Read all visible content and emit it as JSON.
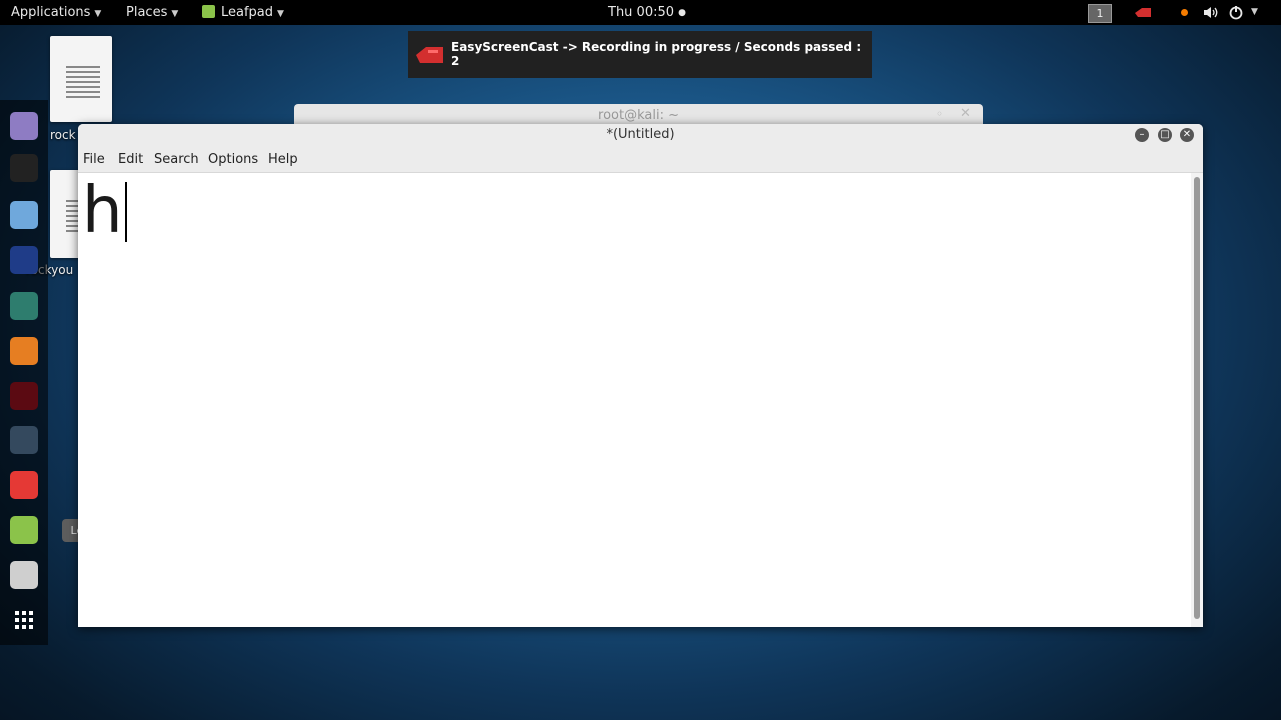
{
  "topbar": {
    "applications": "Applications",
    "places": "Places",
    "app_name": "Leafpad",
    "clock": "Thu 00:50",
    "workspace": "1"
  },
  "notification": {
    "text": "EasyScreenCast -> Recording in progress / Seconds passed : 2",
    "icon": "recording-icon",
    "icon_color": "#d32f2f"
  },
  "desktop": {
    "files": [
      {
        "label": "rock",
        "icon": "text-file-icon"
      },
      {
        "label": "rockyou",
        "icon": "text-file-icon"
      }
    ]
  },
  "dock": {
    "items": [
      {
        "name": "chromium-icon",
        "color": "#8e7cc3"
      },
      {
        "name": "terminal-icon",
        "color": "#222222"
      },
      {
        "name": "files-icon",
        "color": "#6fa8dc"
      },
      {
        "name": "metasploit-icon",
        "color": "#1f3c88"
      },
      {
        "name": "armitage-icon",
        "color": "#2e7d6e"
      },
      {
        "name": "burpsuite-icon",
        "color": "#e67e22"
      },
      {
        "name": "beef-icon",
        "color": "#5b0a12"
      },
      {
        "name": "maltego-icon",
        "color": "#34495e"
      },
      {
        "name": "faraday-icon",
        "color": "#e53935"
      },
      {
        "name": "leafpad-icon",
        "color": "#8bc34a"
      },
      {
        "name": "gedit-icon",
        "color": "#cfcfcf"
      },
      {
        "name": "show-apps-icon",
        "color": "#ffffff"
      }
    ],
    "tooltip": "Leafpad"
  },
  "background_window": {
    "title": "root@kali: ~"
  },
  "window": {
    "title": "*(Untitled)",
    "menu": [
      "File",
      "Edit",
      "Search",
      "Options",
      "Help"
    ],
    "content": "h"
  }
}
